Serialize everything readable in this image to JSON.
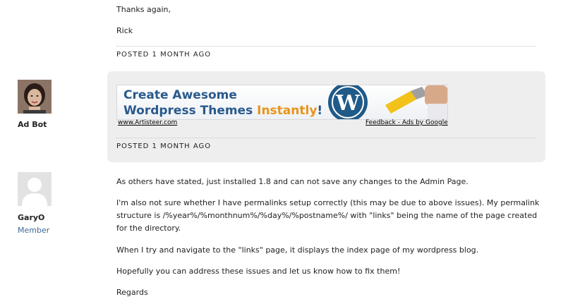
{
  "posts": [
    {
      "lines": [
        "Thanks again,",
        "Rick"
      ],
      "posted": "POSTED 1 MONTH AGO"
    },
    {
      "author": "Ad Bot",
      "ad": {
        "headline1": "Create Awesome",
        "headline2_main": "Wordpress Themes ",
        "headline2_accent": "Instantly",
        "headline2_end": "!",
        "left_link": "www.Artisteer.com",
        "right_link": "Feedback - Ads by Google"
      },
      "posted": "POSTED 1 MONTH AGO"
    },
    {
      "author": "GaryO",
      "role": "Member",
      "paragraphs": [
        "As others have stated, just installed 1.8 and can not save any changes to the Admin Page.",
        "I'm also not sure whether I have permalinks setup correctly (this may be due to above issues). My permalink structure is /%year%/%monthnum%/%day%/%postname%/ with \"links\" being the name of the page created for the directory.",
        "When I try and navigate to the \"links\" page, it displays the index page of my wordpress blog.",
        "Hopefully you can address these issues and let us know how to fix them!",
        "Regards"
      ]
    }
  ],
  "colors": {
    "ad_box_bg": "#eeeeee",
    "member_role": "#3d6a95",
    "ad_text": "#2a5a8c",
    "ad_accent": "#e8941a"
  },
  "icons": {
    "wordpress": "wordpress-logo-icon",
    "brush": "paintbrush-icon",
    "default_avatar": "default-avatar-icon"
  }
}
